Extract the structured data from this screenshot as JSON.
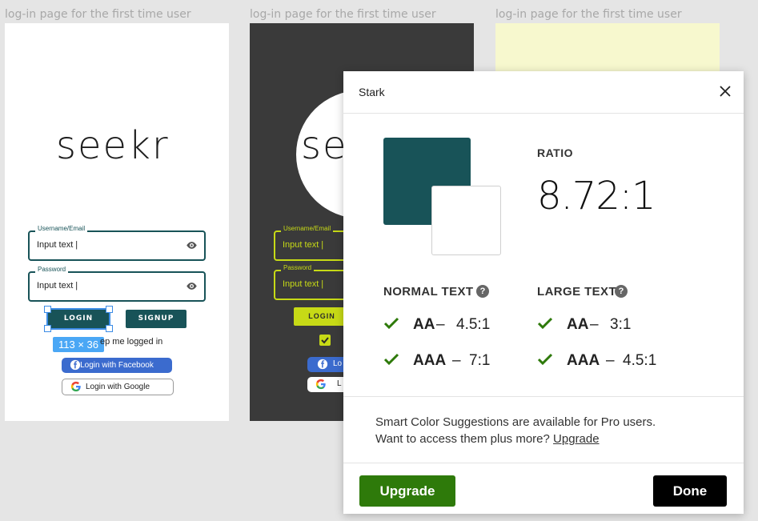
{
  "canvas": {
    "frames": [
      {
        "label": "log-in page for the first time user"
      },
      {
        "label": "log-in page for the first time user"
      },
      {
        "label": "log-in page for the first time user"
      }
    ]
  },
  "login_frame": {
    "logo": "seekr",
    "username": {
      "label": "Username/Email",
      "value": "Input text |"
    },
    "password": {
      "label": "Password",
      "value": "Input text |"
    },
    "login_label": "LOGIN",
    "signup_label": "SIGNUP",
    "selection_size": "113 × 36",
    "keep_logged_in": "ep me logged in",
    "facebook_label": "Login with Facebook",
    "google_label": "Login with Google"
  },
  "dark_frame": {
    "logo": "se",
    "username": {
      "label": "Username/Email",
      "value": "Input text |"
    },
    "password": {
      "label": "Password",
      "value": "Input text |"
    },
    "login_label": "LOGIN",
    "facebook_label": "Lo",
    "google_label": "L"
  },
  "stark": {
    "title": "Stark",
    "colors": {
      "foreground": "#185358",
      "background": "#ffffff",
      "pass": "#2e7a0a"
    },
    "ratio_label": "RATIO",
    "ratio_value": "8.72:1",
    "normal_text": {
      "title": "NORMAL TEXT",
      "aa": {
        "level": "AA",
        "threshold": "4.5:1"
      },
      "aaa": {
        "level": "AAA",
        "threshold": "7:1"
      }
    },
    "large_text": {
      "title": "LARGE TEXT",
      "aa": {
        "level": "AA",
        "threshold": "3:1"
      },
      "aaa": {
        "level": "AAA",
        "threshold": "4.5:1"
      }
    },
    "pro_line1": "Smart Color Suggestions are available for Pro users.",
    "pro_line2": "Want to access them plus more?",
    "pro_link": "Upgrade",
    "upgrade_button": "Upgrade",
    "done_button": "Done"
  }
}
